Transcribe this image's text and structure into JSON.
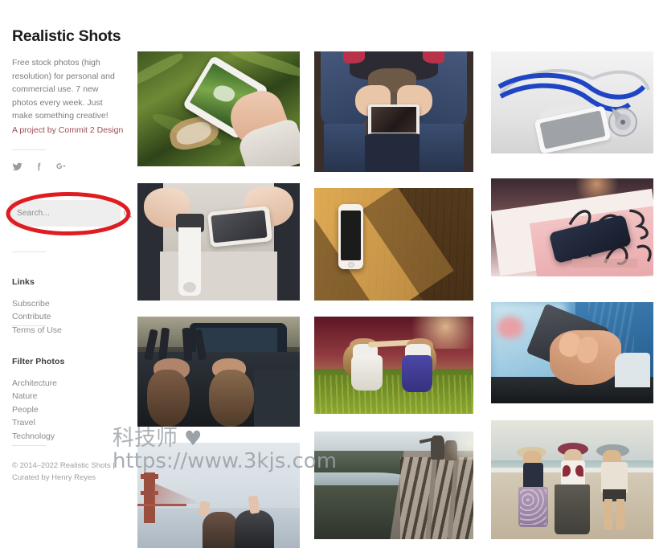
{
  "site": {
    "title": "Realistic Shots",
    "description": "Free stock photos (high resolution) for personal and commercial use. 7 new photos every week. Just make something creative!",
    "project_link": "A project by Commit 2 Design",
    "footer_line_1": "© 2014–2022 Realistic Shots |",
    "footer_line_2": "Curated by Henry Reyes"
  },
  "social": [
    {
      "name": "twitter-icon",
      "label": "Twitter"
    },
    {
      "name": "facebook-icon",
      "label": "f"
    },
    {
      "name": "google-plus-icon",
      "label": "g+"
    }
  ],
  "search": {
    "placeholder": "Search...",
    "value": "",
    "icon": "search-icon"
  },
  "annotation": {
    "shape": "ellipse",
    "color": "#e01b22",
    "stroke_width": 5,
    "target": "search-input"
  },
  "links": {
    "heading": "Links",
    "items": [
      {
        "label": "Subscribe"
      },
      {
        "label": "Contribute"
      },
      {
        "label": "Terms of Use"
      }
    ]
  },
  "filters": {
    "heading": "Filter Photos",
    "items": [
      {
        "label": "Architecture"
      },
      {
        "label": "Nature"
      },
      {
        "label": "People"
      },
      {
        "label": "Travel"
      },
      {
        "label": "Technology"
      }
    ]
  },
  "watermark": {
    "brand": "科技师",
    "heart": "♥",
    "url": "https://www.3kjs.com"
  },
  "colors": {
    "accent_link": "#9d4c5a",
    "annotation_red": "#e01b22",
    "search_bg": "#eeeeee",
    "text_muted": "#8a8a8a",
    "title": "#1c1c1c"
  },
  "gallery": {
    "columns": 3,
    "photos": [
      {
        "id": "p1",
        "col": 1,
        "alt": "Hand holding white smartphone over green grass and leaves"
      },
      {
        "id": "p2",
        "col": 2,
        "alt": "Person in jeans sitting, holding a tablet between legs"
      },
      {
        "id": "p3",
        "col": 3,
        "alt": "Blue stethoscope beside a white smartphone on white desk"
      },
      {
        "id": "p4",
        "col": 1,
        "alt": "Hands holding a white smartwatch and a rose gold phone"
      },
      {
        "id": "p5",
        "col": 2,
        "alt": "White smartphone on a bamboo wood desk with sunlight streak"
      },
      {
        "id": "p6",
        "col": 3,
        "alt": "Navy phone case on a pink Love Life notebook"
      },
      {
        "id": "p7",
        "col": 1,
        "alt": "Two girls lying back on the hood of a vintage car"
      },
      {
        "id": "p8",
        "col": 2,
        "alt": "Two girls bending over in a yellow flower field at sunset"
      },
      {
        "id": "p9",
        "col": 3,
        "alt": "Man in blue shirt holding a black smartphone"
      },
      {
        "id": "p10",
        "col": 1,
        "alt": "Two girls at the Golden Gate Bridge raising peace signs"
      },
      {
        "id": "p11",
        "col": 2,
        "alt": "Couple walking along railroad tracks in misty light"
      },
      {
        "id": "p12",
        "col": 3,
        "alt": "Three women in sun hats standing on the beach"
      }
    ]
  }
}
